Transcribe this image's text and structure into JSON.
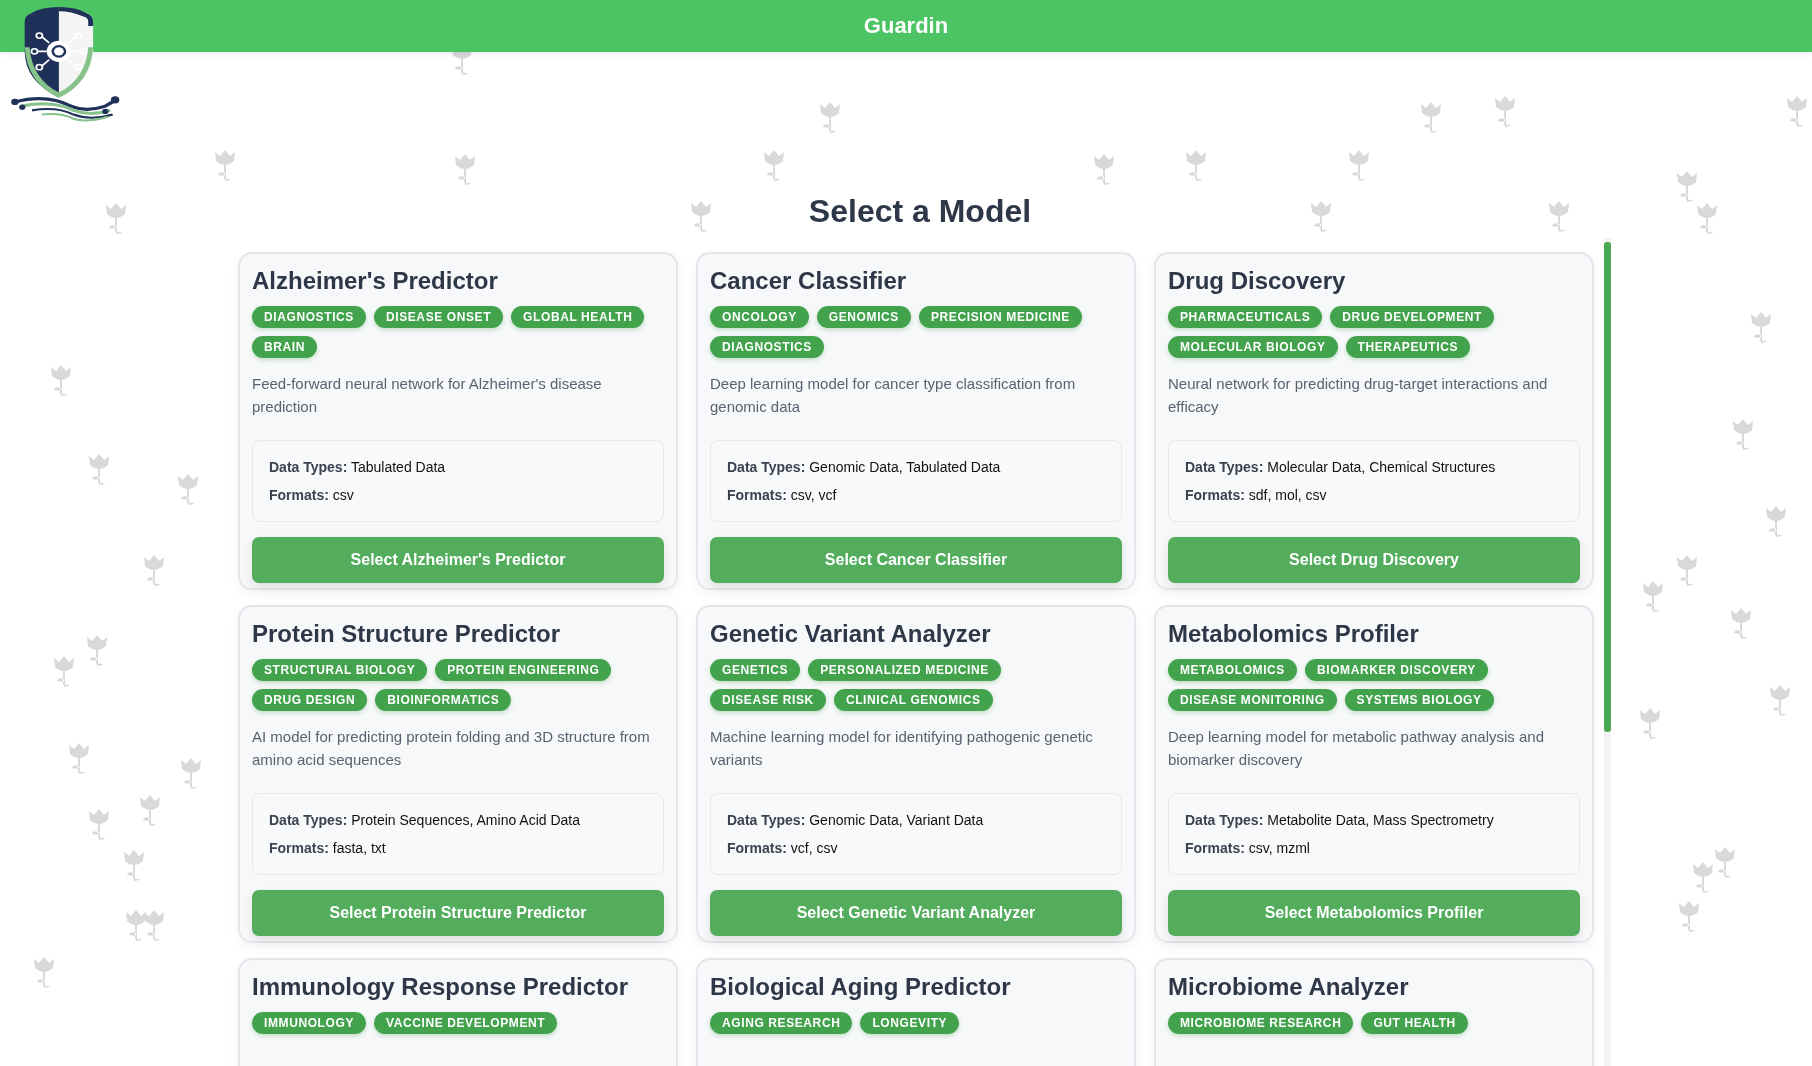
{
  "header": {
    "title": "Guardin"
  },
  "page_title": "Select a Model",
  "models": [
    {
      "name": "Alzheimer's Predictor",
      "tags": [
        "DIAGNOSTICS",
        "DISEASE ONSET",
        "GLOBAL HEALTH",
        "BRAIN"
      ],
      "description": "Feed-forward neural network for Alzheimer's disease prediction",
      "data_types": "**Data Types:** Tabulated Data",
      "formats": "**Formats:** csv",
      "button": "Select Alzheimer's Predictor"
    },
    {
      "name": "Cancer Classifier",
      "tags": [
        "ONCOLOGY",
        "GENOMICS",
        "PRECISION MEDICINE",
        "DIAGNOSTICS"
      ],
      "description": "Deep learning model for cancer type classification from genomic data",
      "data_types": "**Data Types:** Genomic Data, Tabulated Data",
      "formats": "**Formats:** csv, vcf",
      "button": "Select Cancer Classifier"
    },
    {
      "name": "Drug Discovery",
      "tags": [
        "PHARMACEUTICALS",
        "DRUG DEVELOPMENT",
        "MOLECULAR BIOLOGY",
        "THERAPEUTICS"
      ],
      "description": "Neural network for predicting drug-target interactions and efficacy",
      "data_types": "**Data Types:** Molecular Data, Chemical Structures",
      "formats": "**Formats:** sdf, mol, csv",
      "button": "Select Drug Discovery"
    },
    {
      "name": "Protein Structure Predictor",
      "tags": [
        "STRUCTURAL BIOLOGY",
        "PROTEIN ENGINEERING",
        "DRUG DESIGN",
        "BIOINFORMATICS"
      ],
      "description": "AI model for predicting protein folding and 3D structure from amino acid sequences",
      "data_types": "**Data Types:** Protein Sequences, Amino Acid Data",
      "formats": "**Formats:** fasta, txt",
      "button": "Select Protein Structure Predictor"
    },
    {
      "name": "Genetic Variant Analyzer",
      "tags": [
        "GENETICS",
        "PERSONALIZED MEDICINE",
        "DISEASE RISK",
        "CLINICAL GENOMICS"
      ],
      "description": "Machine learning model for identifying pathogenic genetic variants",
      "data_types": "**Data Types:** Genomic Data, Variant Data",
      "formats": "**Formats:** vcf, csv",
      "button": "Select Genetic Variant Analyzer"
    },
    {
      "name": "Metabolomics Profiler",
      "tags": [
        "METABOLOMICS",
        "BIOMARKER DISCOVERY",
        "DISEASE MONITORING",
        "SYSTEMS BIOLOGY"
      ],
      "description": "Deep learning model for metabolic pathway analysis and biomarker discovery",
      "data_types": "**Data Types:** Metabolite Data, Mass Spectrometry",
      "formats": "**Formats:** csv, mzml",
      "button": "Select Metabolomics Profiler"
    },
    {
      "name": "Immunology Response Predictor",
      "tags": [
        "IMMUNOLOGY",
        "VACCINE DEVELOPMENT"
      ]
    },
    {
      "name": "Biological Aging Predictor",
      "tags": [
        "AGING RESEARCH",
        "LONGEVITY"
      ]
    },
    {
      "name": "Microbiome Analyzer",
      "tags": [
        "MICROBIOME RESEARCH",
        "GUT HEALTH"
      ]
    }
  ]
}
